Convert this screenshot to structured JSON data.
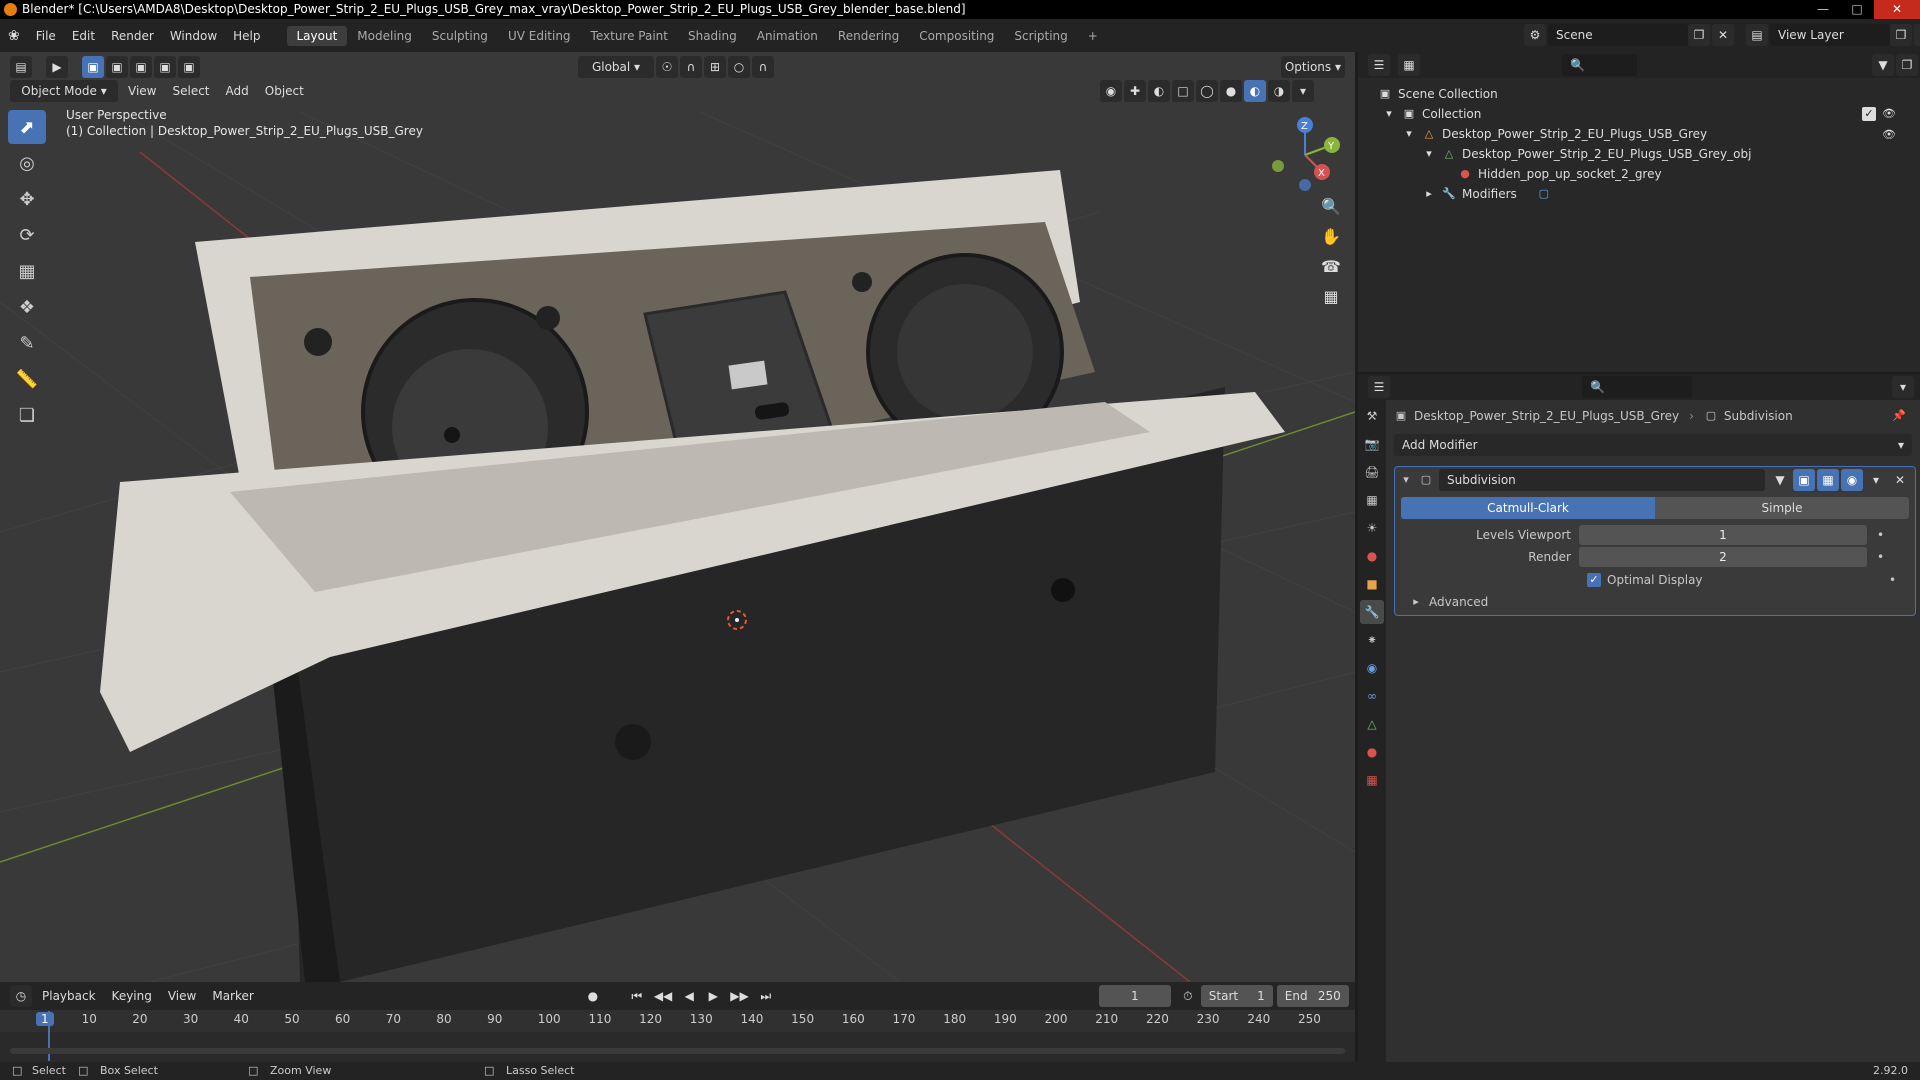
{
  "window": {
    "title": "Blender* [C:\\Users\\AMDA8\\Desktop\\Desktop_Power_Strip_2_EU_Plugs_USB_Grey_max_vray\\Desktop_Power_Strip_2_EU_Plugs_USB_Grey_blender_base.blend]"
  },
  "menu": {
    "items": [
      "File",
      "Edit",
      "Render",
      "Window",
      "Help"
    ]
  },
  "workspaces": {
    "tabs": [
      "Layout",
      "Modeling",
      "Sculpting",
      "UV Editing",
      "Texture Paint",
      "Shading",
      "Animation",
      "Rendering",
      "Compositing",
      "Scripting"
    ],
    "add": "+"
  },
  "topright": {
    "scene": "Scene",
    "view_layer": "View Layer"
  },
  "viewport": {
    "mode": "Object Mode",
    "menus": [
      "View",
      "Select",
      "Add",
      "Object"
    ],
    "transform_orientation": "Global",
    "options": "Options",
    "info_line1": "User Perspective",
    "info_line2": "(1) Collection | Desktop_Power_Strip_2_EU_Plugs_USB_Grey",
    "gizmo": {
      "x": "X",
      "y": "Y",
      "z": "Z"
    }
  },
  "outliner": {
    "scene_collection": "Scene Collection",
    "collection": "Collection",
    "object": "Desktop_Power_Strip_2_EU_Plugs_USB_Grey",
    "mesh": "Desktop_Power_Strip_2_EU_Plugs_USB_Grey_obj",
    "material": "Hidden_pop_up_socket_2_grey",
    "modifiers": "Modifiers"
  },
  "properties": {
    "breadcrumb_object": "Desktop_Power_Strip_2_EU_Plugs_USB_Grey",
    "breadcrumb_modifier": "Subdivision",
    "add_modifier": "Add Modifier",
    "modifier_name": "Subdivision",
    "type_catmull": "Catmull-Clark",
    "type_simple": "Simple",
    "levels_viewport_label": "Levels Viewport",
    "levels_viewport_value": "1",
    "render_label": "Render",
    "render_value": "2",
    "optimal_display": "Optimal Display",
    "advanced": "Advanced"
  },
  "timeline": {
    "menus": [
      "Playback",
      "Keying",
      "View",
      "Marker"
    ],
    "current_frame": "1",
    "start_label": "Start",
    "start_value": "1",
    "end_label": "End",
    "end_value": "250",
    "ruler": [
      "1",
      "10",
      "20",
      "30",
      "40",
      "50",
      "60",
      "70",
      "80",
      "90",
      "100",
      "110",
      "120",
      "130",
      "140",
      "150",
      "160",
      "170",
      "180",
      "190",
      "200",
      "210",
      "220",
      "230",
      "240",
      "250"
    ]
  },
  "statusbar": {
    "select": "Select",
    "box_select": "Box Select",
    "zoom_view": "Zoom View",
    "lasso_select": "Lasso Select",
    "version": "2.92.0"
  },
  "colors": {
    "accent": "#4772b3",
    "header_bg": "#232323",
    "viewport_bg": "#393939",
    "panel_bg": "#303030",
    "blender_orange": "#e87d0d"
  }
}
